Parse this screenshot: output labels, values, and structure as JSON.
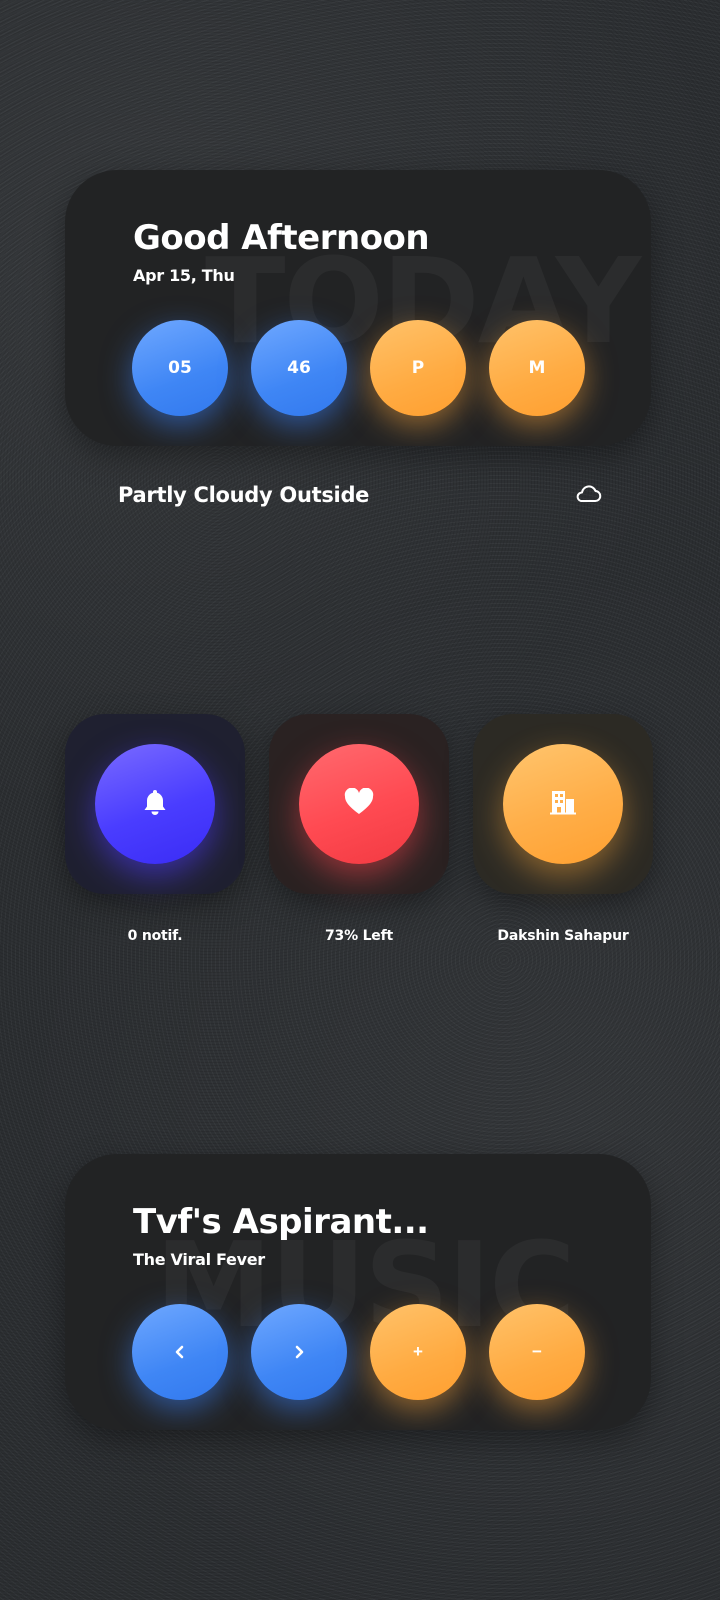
{
  "clock_card": {
    "watermark": "TODAY",
    "greeting": "Good Afternoon",
    "date": "Apr 15, Thu",
    "hour": "05",
    "minute": "46",
    "ampm_first": "P",
    "ampm_second": "M"
  },
  "weather": {
    "text": "Partly Cloudy Outside",
    "icon": "cloud-icon"
  },
  "tiles": [
    {
      "icon": "bell-icon",
      "label": "0 notif.",
      "color": "#4a3dff"
    },
    {
      "icon": "heart-icon",
      "label": "73% Left",
      "color": "#ff4a52"
    },
    {
      "icon": "building-icon",
      "label": "Dakshin Sahapur",
      "color": "#ffae48"
    }
  ],
  "music_card": {
    "watermark": "MUSIC",
    "track_title": "Tvf's Aspirant...",
    "artist": "The Viral Fever",
    "prev_icon": "chevron-left-icon",
    "next_icon": "chevron-right-icon",
    "volume_up_label": "+",
    "volume_down_label": "−"
  },
  "colors": {
    "blue": "#3f86f5",
    "orange": "#ffab42",
    "card_bg": "#222324"
  }
}
